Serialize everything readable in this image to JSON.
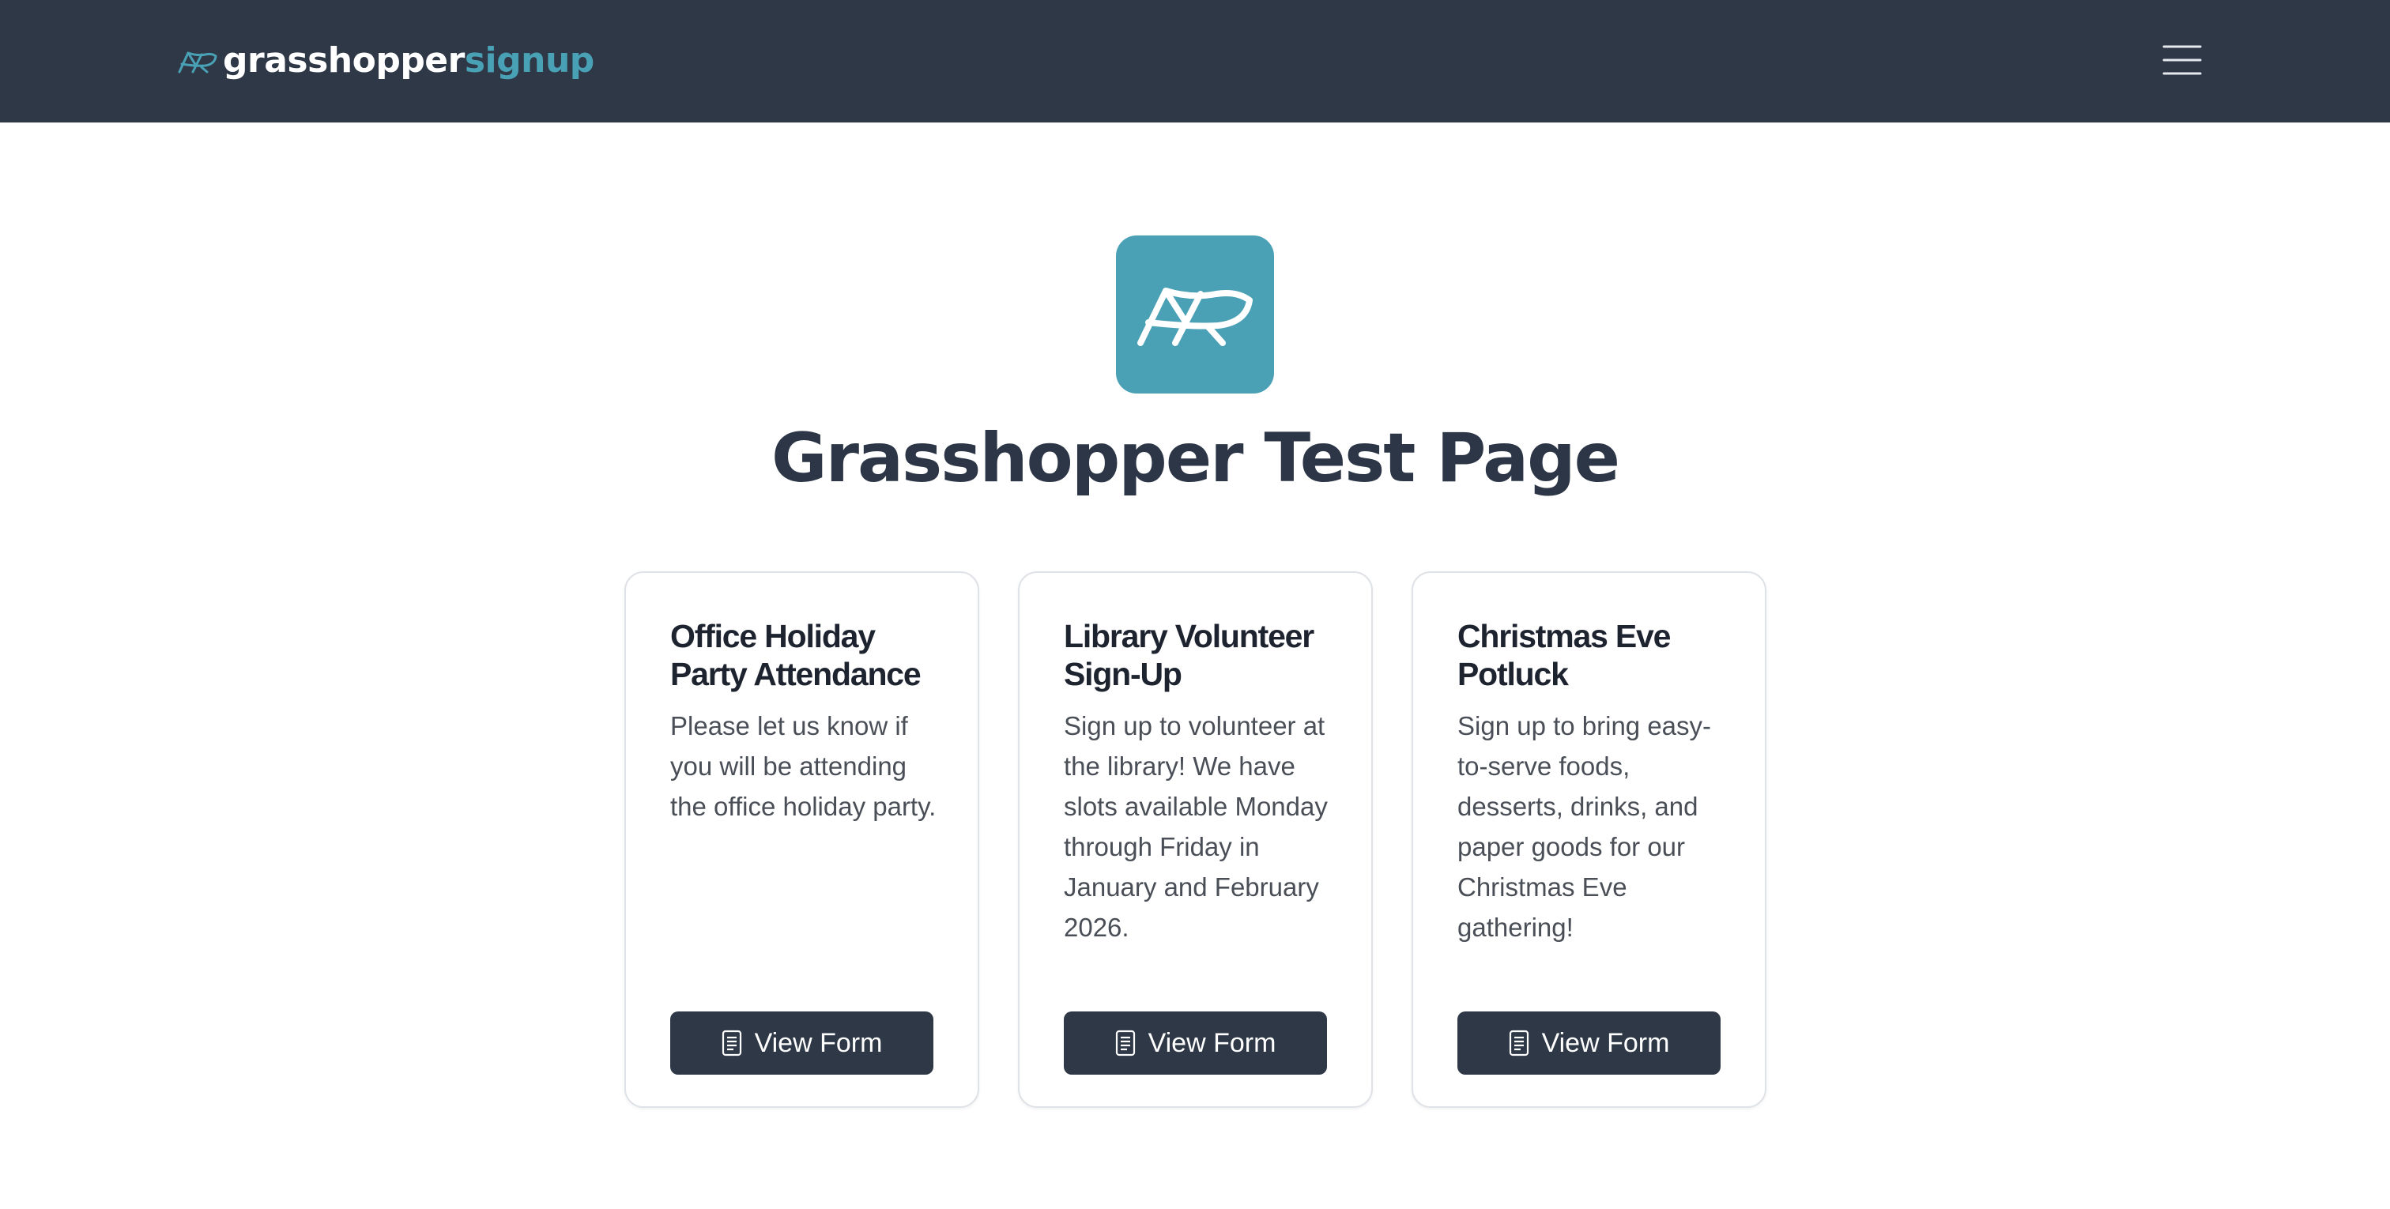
{
  "brand": {
    "name_part1": "grasshopper",
    "name_part2": "signup",
    "accent_color": "#49a1b5",
    "icon": "grasshopper-icon"
  },
  "navbar": {
    "menu_icon": "hamburger-menu-icon",
    "background": "#2f3847"
  },
  "hero": {
    "logo_icon": "grasshopper-icon",
    "title": "Grasshopper Test Page"
  },
  "cards": [
    {
      "title": "Office Holiday Party Attendance",
      "description": "Please let us know if you will be attending the office holiday party.",
      "button_label": "View Form",
      "button_icon": "document-icon"
    },
    {
      "title": "Library Volunteer Sign-Up",
      "description": "Sign up to volunteer at the library! We have slots available Monday through Friday in January and February 2026.",
      "button_label": "View Form",
      "button_icon": "document-icon"
    },
    {
      "title": "Christmas Eve Potluck",
      "description": "Sign up to bring easy-to-serve foods, desserts, drinks, and paper goods for our Christmas Eve gathering!",
      "button_label": "View Form",
      "button_icon": "document-icon"
    }
  ]
}
